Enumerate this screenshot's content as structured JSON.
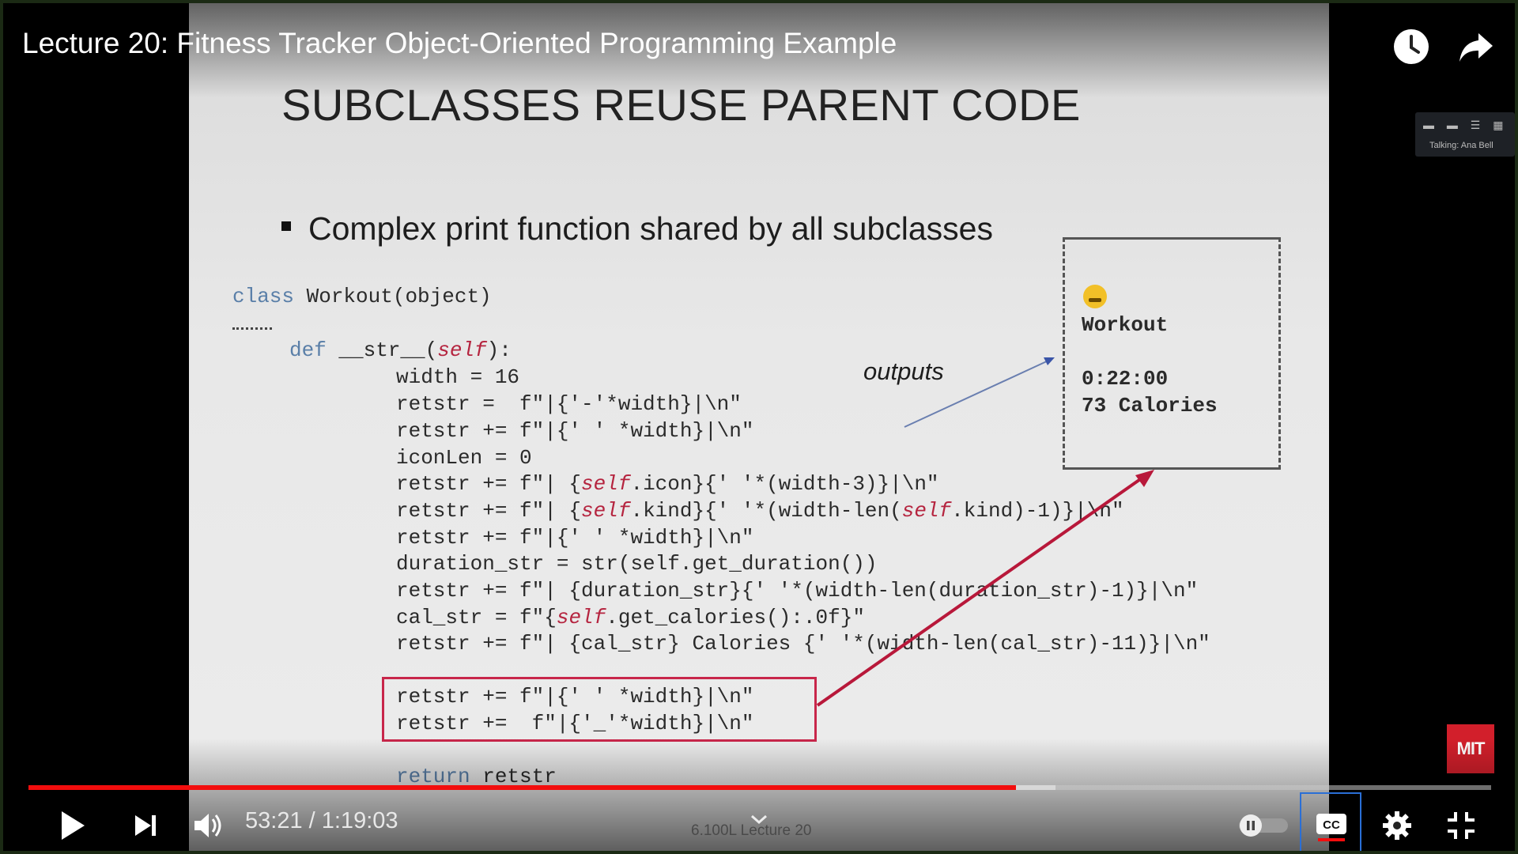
{
  "header": {
    "title": "Lecture 20: Fitness Tracker Object-Oriented Programming Example",
    "icons": [
      "clock-icon",
      "share-arrow-icon"
    ]
  },
  "slide": {
    "heading": "SUBCLASSES REUSE PARENT CODE",
    "bullet": "Complex print function shared by all subclasses",
    "code": {
      "class_kw": "class",
      "class_rest": " Workout(object)",
      "def_kw": "def",
      "def_name": " __str__(",
      "def_self": "self",
      "def_end": "):",
      "l1": "width = 16",
      "l2": "retstr =  f\"|{'-'*width}|\\n\"",
      "l3": "retstr += f\"|{' ' *width}|\\n\"",
      "l4": "iconLen = 0",
      "l5a": "retstr += f\"| {",
      "l5b": "self",
      "l5c": ".icon}{' '*(width-3)}|\\n\"",
      "l6a": "retstr += f\"| {",
      "l6b": "self",
      "l6c": ".kind}{' '*(width-len(",
      "l6d": "self",
      "l6e": ".kind)-1)}|\\n\"",
      "l7": "retstr += f\"|{' ' *width}|\\n\"",
      "l8": "duration_str = str(self.get_duration())",
      "l9": "retstr += f\"| {duration_str}{' '*(width-len(duration_str)-1)}|\\n\"",
      "l10a": "cal_str = f\"{",
      "l10b": "self",
      "l10c": ".get_calories():.0f}\"",
      "l11": "retstr += f\"| {cal_str} Calories {' '*(width-len(cal_str)-11)}|\\n\"",
      "h1": "retstr += f\"|{' ' *width}|\\n\"",
      "h2": "retstr +=  f\"|{'_'*width}|\\n\"",
      "ret_kw": "return",
      "ret_rest": " retstr"
    },
    "outputs_label": "outputs",
    "output_box": {
      "line_kind": "Workout",
      "line_duration": "0:22:00",
      "line_calories": "73 Calories"
    },
    "meeting_overlay": {
      "talking": "Talking: Ana Bell"
    },
    "logo_text": "MIT",
    "watermark": "6.100L Lecture 20"
  },
  "player": {
    "current_time": "53:21",
    "separator": " / ",
    "duration": "1:19:03",
    "progress_fraction": 0.6751,
    "buffered_fraction": 0.702,
    "colors": {
      "played": "#f20d0d",
      "accent_cc": "#2a6fd6"
    }
  }
}
